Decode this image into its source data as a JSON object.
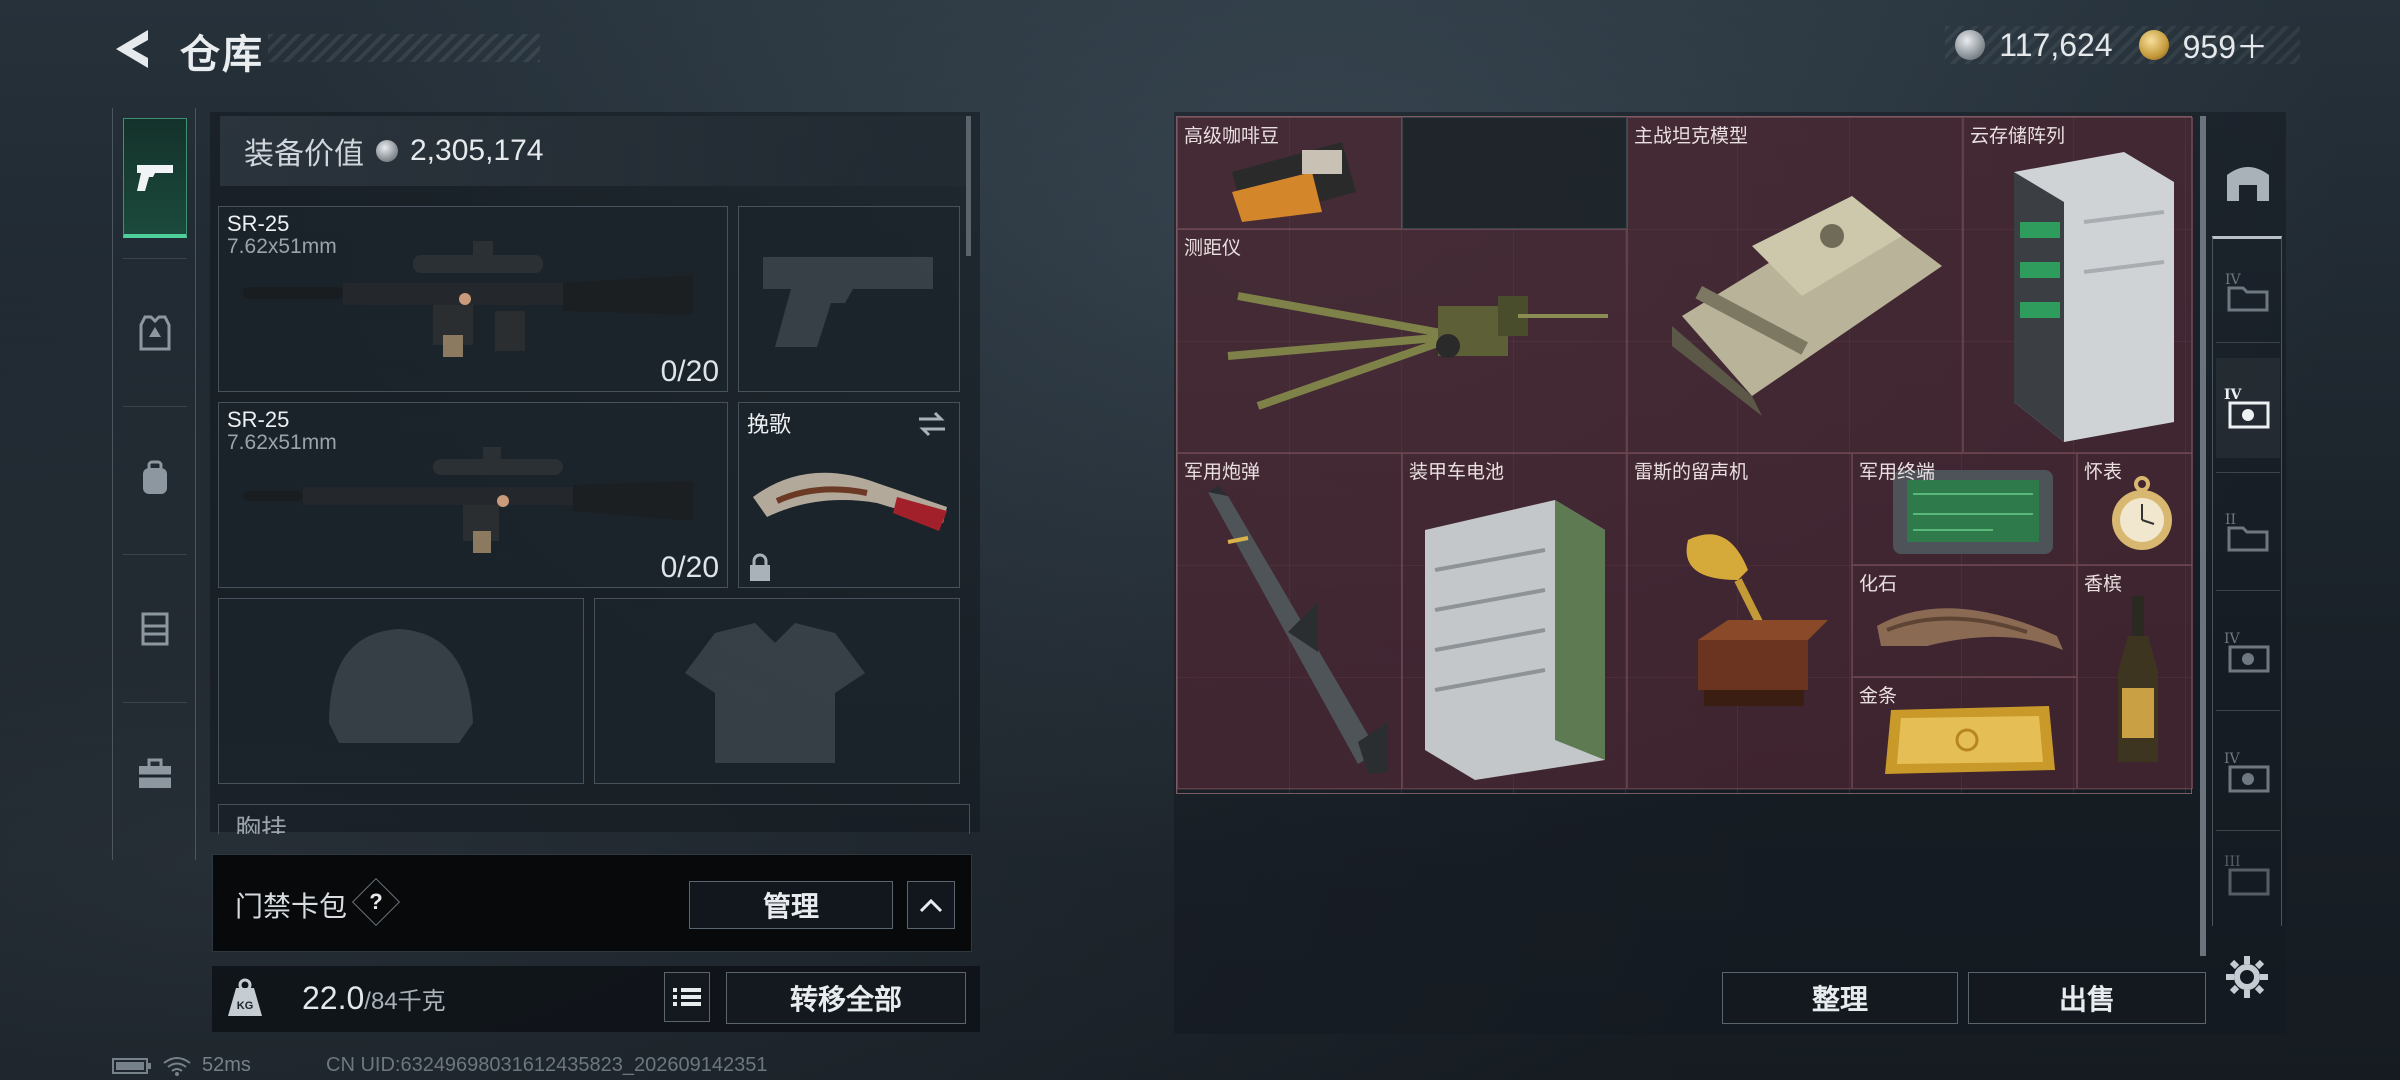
{
  "header": {
    "title": "仓库",
    "currencies": [
      {
        "icon": "silver-coin-icon",
        "value": "117,624"
      },
      {
        "icon": "gold-coin-icon",
        "value": "959＋"
      }
    ]
  },
  "rail": {
    "items": [
      "pistol-icon",
      "armor-vest-icon",
      "backpack-icon",
      "chest-rig-icon",
      "toolbox-icon"
    ],
    "active": 0
  },
  "loadout": {
    "value_label": "装备价值",
    "value": "2,305,174",
    "primary1": {
      "name": "SR-25",
      "caliber": "7.62x51mm",
      "ammo": "0/20"
    },
    "primary2": {
      "name": "SR-25",
      "caliber": "7.62x51mm",
      "ammo": "0/20"
    },
    "melee": {
      "name": "挽歌"
    },
    "chest_label": "胸挂"
  },
  "keycard": {
    "label": "门禁卡包",
    "help": "?",
    "manage": "管理"
  },
  "weight": {
    "current": "22.0",
    "max": "/84千克",
    "transfer_all": "转移全部"
  },
  "status": {
    "ping": "52ms",
    "uid": "CN UID:6324969803161243582​3_202609142351"
  },
  "stash": {
    "items": [
      "高级咖啡豆",
      "主战坦克模型",
      "云存储阵列",
      "测距仪",
      "军用炮弹",
      "装甲车电池",
      "雷斯的留声机",
      "军用终端",
      "怀表",
      "化石",
      "香槟",
      "金条"
    ],
    "sort": "整理",
    "sell": "出售"
  },
  "colors": {
    "accent": "#4fcf9c",
    "item_bg": "#6a2f3c"
  }
}
